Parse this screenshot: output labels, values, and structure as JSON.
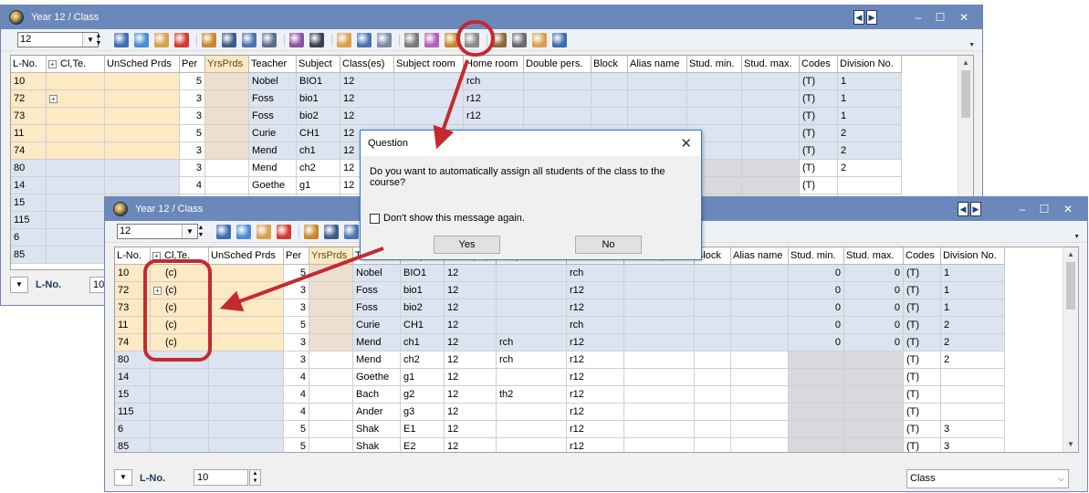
{
  "back_window": {
    "title": "Year 12 / Class",
    "combo_value": "12",
    "columns": [
      "L-No.",
      "Cl,Te.",
      "UnSched Prds",
      "Per",
      "YrsPrds",
      "Teacher",
      "Subject",
      "Class(es)",
      "Subject room",
      "Home room",
      "Double pers.",
      "Block",
      "Alias name",
      "Stud. min.",
      "Stud. max.",
      "Codes",
      "Division No."
    ],
    "rows": [
      {
        "lno": "10",
        "clte": "",
        "per": "5",
        "teacher": "Nobel",
        "subject": "BIO1",
        "classes": "12",
        "home": "rch",
        "codes": "(T)",
        "div": "1"
      },
      {
        "lno": "72",
        "clte": "",
        "per": "3",
        "teacher": "Foss",
        "subject": "bio1",
        "classes": "12",
        "home": "r12",
        "codes": "(T)",
        "div": "1"
      },
      {
        "lno": "73",
        "clte": "",
        "per": "3",
        "teacher": "Foss",
        "subject": "bio2",
        "classes": "12",
        "home": "r12",
        "codes": "(T)",
        "div": "1"
      },
      {
        "lno": "11",
        "clte": "",
        "per": "5",
        "teacher": "Curie",
        "subject": "CH1",
        "classes": "12",
        "home": "",
        "codes": "(T)",
        "div": "2"
      },
      {
        "lno": "74",
        "clte": "",
        "per": "3",
        "teacher": "Mend",
        "subject": "ch1",
        "classes": "12",
        "home": "",
        "codes": "(T)",
        "div": "2"
      },
      {
        "lno": "80",
        "clte": "",
        "per": "3",
        "teacher": "Mend",
        "subject": "ch2",
        "classes": "12",
        "home": "",
        "codes": "(T)",
        "div": "2"
      },
      {
        "lno": "14",
        "clte": "",
        "per": "4",
        "teacher": "Goethe",
        "subject": "g1",
        "classes": "12",
        "home": "",
        "codes": "(T)",
        "div": ""
      },
      {
        "lno": "15",
        "clte": "",
        "per": "",
        "teacher": "",
        "subject": "",
        "classes": "",
        "home": "",
        "codes": "",
        "div": ""
      },
      {
        "lno": "115",
        "clte": "",
        "per": "",
        "teacher": "",
        "subject": "",
        "classes": "",
        "home": "",
        "codes": "",
        "div": ""
      },
      {
        "lno": "6",
        "clte": "",
        "per": "",
        "teacher": "",
        "subject": "",
        "classes": "",
        "home": "",
        "codes": "",
        "div": ""
      },
      {
        "lno": "85",
        "clte": "",
        "per": "",
        "teacher": "",
        "subject": "",
        "classes": "",
        "home": "",
        "codes": "",
        "div": ""
      }
    ],
    "status_label": "L-No.",
    "status_value": "10"
  },
  "dialog": {
    "title": "Question",
    "message": "Do you want to automatically assign all students of the class to the course?",
    "checkbox_label": "Don't show this message again.",
    "yes_label": "Yes",
    "no_label": "No"
  },
  "front_window": {
    "title": "Year 12 / Class",
    "combo_value": "12",
    "columns": [
      "L-No.",
      "Cl,Te.",
      "UnSched Prds",
      "Per",
      "YrsPrds",
      "Teacher",
      "Subject",
      "Class(es)",
      "Subject room",
      "Home room",
      "Double pers.",
      "Block",
      "Alias name",
      "Stud. min.",
      "Stud. max.",
      "Codes",
      "Division No."
    ],
    "rows": [
      {
        "lno": "10",
        "clte": "(c)",
        "per": "5",
        "teacher": "Nobel",
        "subject": "BIO1",
        "classes": "12",
        "subjroom": "",
        "home": "rch",
        "smin": "0",
        "smax": "0",
        "codes": "(T)",
        "div": "1"
      },
      {
        "lno": "72",
        "clte": "(c)",
        "per": "3",
        "teacher": "Foss",
        "subject": "bio1",
        "classes": "12",
        "subjroom": "",
        "home": "r12",
        "smin": "0",
        "smax": "0",
        "codes": "(T)",
        "div": "1"
      },
      {
        "lno": "73",
        "clte": "(c)",
        "per": "3",
        "teacher": "Foss",
        "subject": "bio2",
        "classes": "12",
        "subjroom": "",
        "home": "r12",
        "smin": "0",
        "smax": "0",
        "codes": "(T)",
        "div": "1"
      },
      {
        "lno": "11",
        "clte": "(c)",
        "per": "5",
        "teacher": "Curie",
        "subject": "CH1",
        "classes": "12",
        "subjroom": "",
        "home": "rch",
        "smin": "0",
        "smax": "0",
        "codes": "(T)",
        "div": "2"
      },
      {
        "lno": "74",
        "clte": "(c)",
        "per": "3",
        "teacher": "Mend",
        "subject": "ch1",
        "classes": "12",
        "subjroom": "rch",
        "home": "r12",
        "smin": "0",
        "smax": "0",
        "codes": "(T)",
        "div": "2"
      },
      {
        "lno": "80",
        "clte": "",
        "per": "3",
        "teacher": "Mend",
        "subject": "ch2",
        "classes": "12",
        "subjroom": "rch",
        "home": "r12",
        "smin": "",
        "smax": "",
        "codes": "(T)",
        "div": "2"
      },
      {
        "lno": "14",
        "clte": "",
        "per": "4",
        "teacher": "Goethe",
        "subject": "g1",
        "classes": "12",
        "subjroom": "",
        "home": "r12",
        "smin": "",
        "smax": "",
        "codes": "(T)",
        "div": ""
      },
      {
        "lno": "15",
        "clte": "",
        "per": "4",
        "teacher": "Bach",
        "subject": "g2",
        "classes": "12",
        "subjroom": "th2",
        "home": "r12",
        "smin": "",
        "smax": "",
        "codes": "(T)",
        "div": ""
      },
      {
        "lno": "115",
        "clte": "",
        "per": "4",
        "teacher": "Ander",
        "subject": "g3",
        "classes": "12",
        "subjroom": "",
        "home": "r12",
        "smin": "",
        "smax": "",
        "codes": "(T)",
        "div": ""
      },
      {
        "lno": "6",
        "clte": "",
        "per": "5",
        "teacher": "Shak",
        "subject": "E1",
        "classes": "12",
        "subjroom": "",
        "home": "r12",
        "smin": "",
        "smax": "",
        "codes": "(T)",
        "div": "3"
      },
      {
        "lno": "85",
        "clte": "",
        "per": "5",
        "teacher": "Shak",
        "subject": "E2",
        "classes": "12",
        "subjroom": "",
        "home": "r12",
        "smin": "",
        "smax": "",
        "codes": "(T)",
        "div": "3"
      }
    ],
    "status_label": "L-No.",
    "status_value": "10",
    "view_select": "Class"
  },
  "colors": {
    "titlebar": "#6a88b9",
    "highlight": "#c42a2f",
    "row_orange": "#fde9c4",
    "row_blue": "#dbe4f0"
  }
}
